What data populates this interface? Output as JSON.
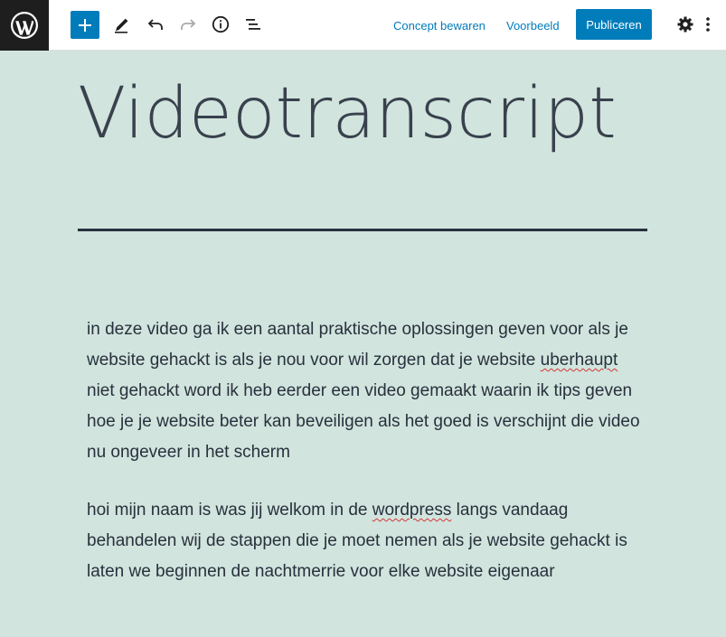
{
  "toolbar": {
    "add_block_label": "+",
    "save_draft_label": "Concept bewaren",
    "preview_label": "Voorbeeld",
    "publish_label": "Publiceren"
  },
  "colors": {
    "accent": "#007cba",
    "canvas_background": "#d1e4dd",
    "text": "#28303d",
    "logo_background": "#1e1e1e"
  },
  "icons": [
    "wordpress-logo-icon",
    "plus-icon",
    "pencil-icon",
    "undo-icon",
    "redo-icon",
    "info-icon",
    "list-view-icon",
    "gear-icon",
    "more-vertical-icon"
  ],
  "post": {
    "title": "Videotranscript",
    "paragraphs": [
      [
        {
          "text": "in deze video ga ik een aantal praktische oplossingen geven voor als je website gehackt is als je nou voor wil zorgen dat je website ",
          "spell": false
        },
        {
          "text": "uberhaupt",
          "spell": true
        },
        {
          "text": " niet gehackt word ik heb eerder een video gemaakt waarin ik tips geven hoe je je website beter kan beveiligen als het goed is verschijnt die video nu ongeveer in het scherm",
          "spell": false
        }
      ],
      [
        {
          "text": "hoi mijn naam is was jij welkom in de ",
          "spell": false
        },
        {
          "text": "wordpress",
          "spell": true
        },
        {
          "text": " langs vandaag behandelen wij de stappen die je moet nemen als je website gehackt is laten we beginnen de nachtmerrie voor elke website eigenaar",
          "spell": false
        }
      ]
    ]
  }
}
